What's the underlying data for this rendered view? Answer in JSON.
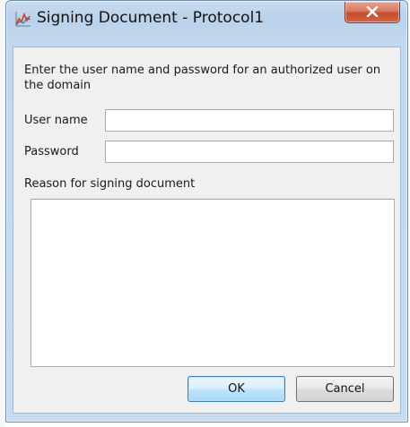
{
  "window": {
    "title": "Signing Document - Protocol1",
    "close_symbol": "X"
  },
  "dialog": {
    "instructions": "Enter the user name and password for an authorized user on the domain",
    "username_label": "User name",
    "username_value": "",
    "password_label": "Password",
    "password_value": "",
    "reason_label": "Reason for signing document",
    "reason_value": ""
  },
  "buttons": {
    "ok_label": "OK",
    "cancel_label": "Cancel"
  },
  "colors": {
    "frame": "#c2d7ed",
    "close_button": "#c64b2d",
    "default_button_border": "#3c7fb1"
  },
  "icons": {
    "app": "chart-icon",
    "close": "close-icon"
  }
}
